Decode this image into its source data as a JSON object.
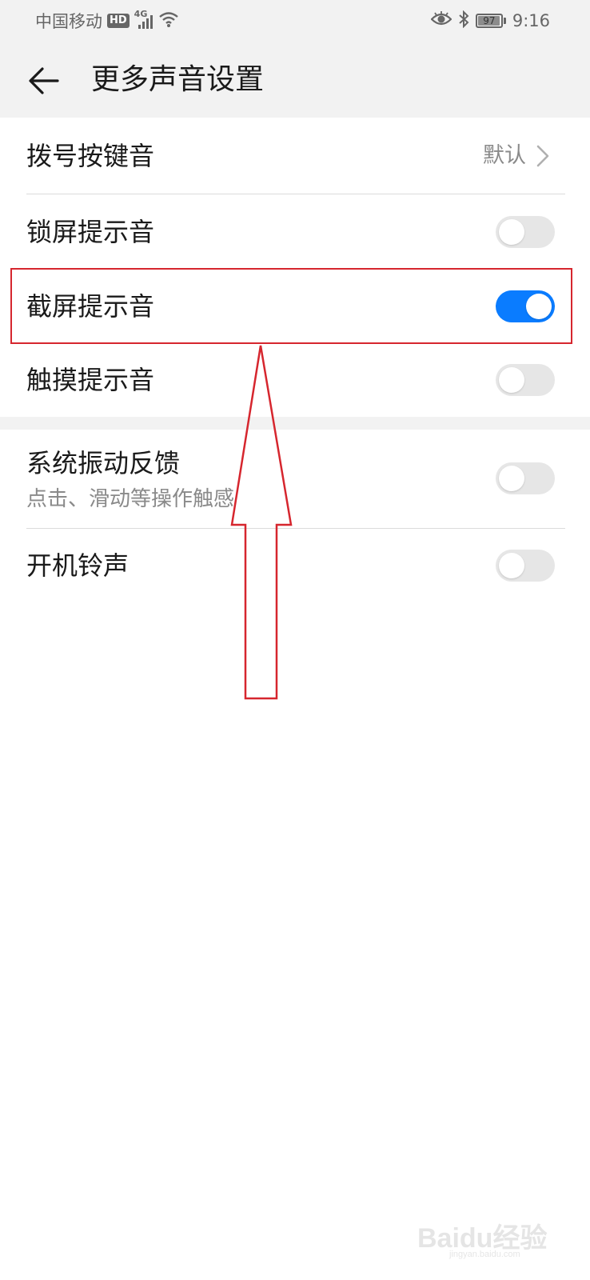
{
  "status_bar": {
    "carrier": "中国移动",
    "hd_label": "HD",
    "network_label": "4G",
    "battery_level": "97",
    "battery_fraction": 0.97,
    "time": "9:16"
  },
  "header": {
    "title": "更多声音设置",
    "back_icon": "arrow-left-icon"
  },
  "settings": {
    "dial_tone": {
      "label": "拨号按键音",
      "value": "默认"
    },
    "lock_sound": {
      "label": "锁屏提示音",
      "enabled": false
    },
    "screenshot_sound": {
      "label": "截屏提示音",
      "enabled": true
    },
    "touch_sound": {
      "label": "触摸提示音",
      "enabled": false
    },
    "vibration_feedback": {
      "label": "系统振动反馈",
      "subtitle": "点击、滑动等操作触感",
      "enabled": false
    },
    "boot_ringtone": {
      "label": "开机铃声",
      "enabled": false
    }
  },
  "colors": {
    "accent": "#0a7cff",
    "toggle_off": "#e6e6e6",
    "annotation": "#d6262e",
    "header_bg": "#f2f2f2"
  },
  "watermark": {
    "main": "Baidu经验",
    "sub": "jingyan.baidu.com"
  }
}
